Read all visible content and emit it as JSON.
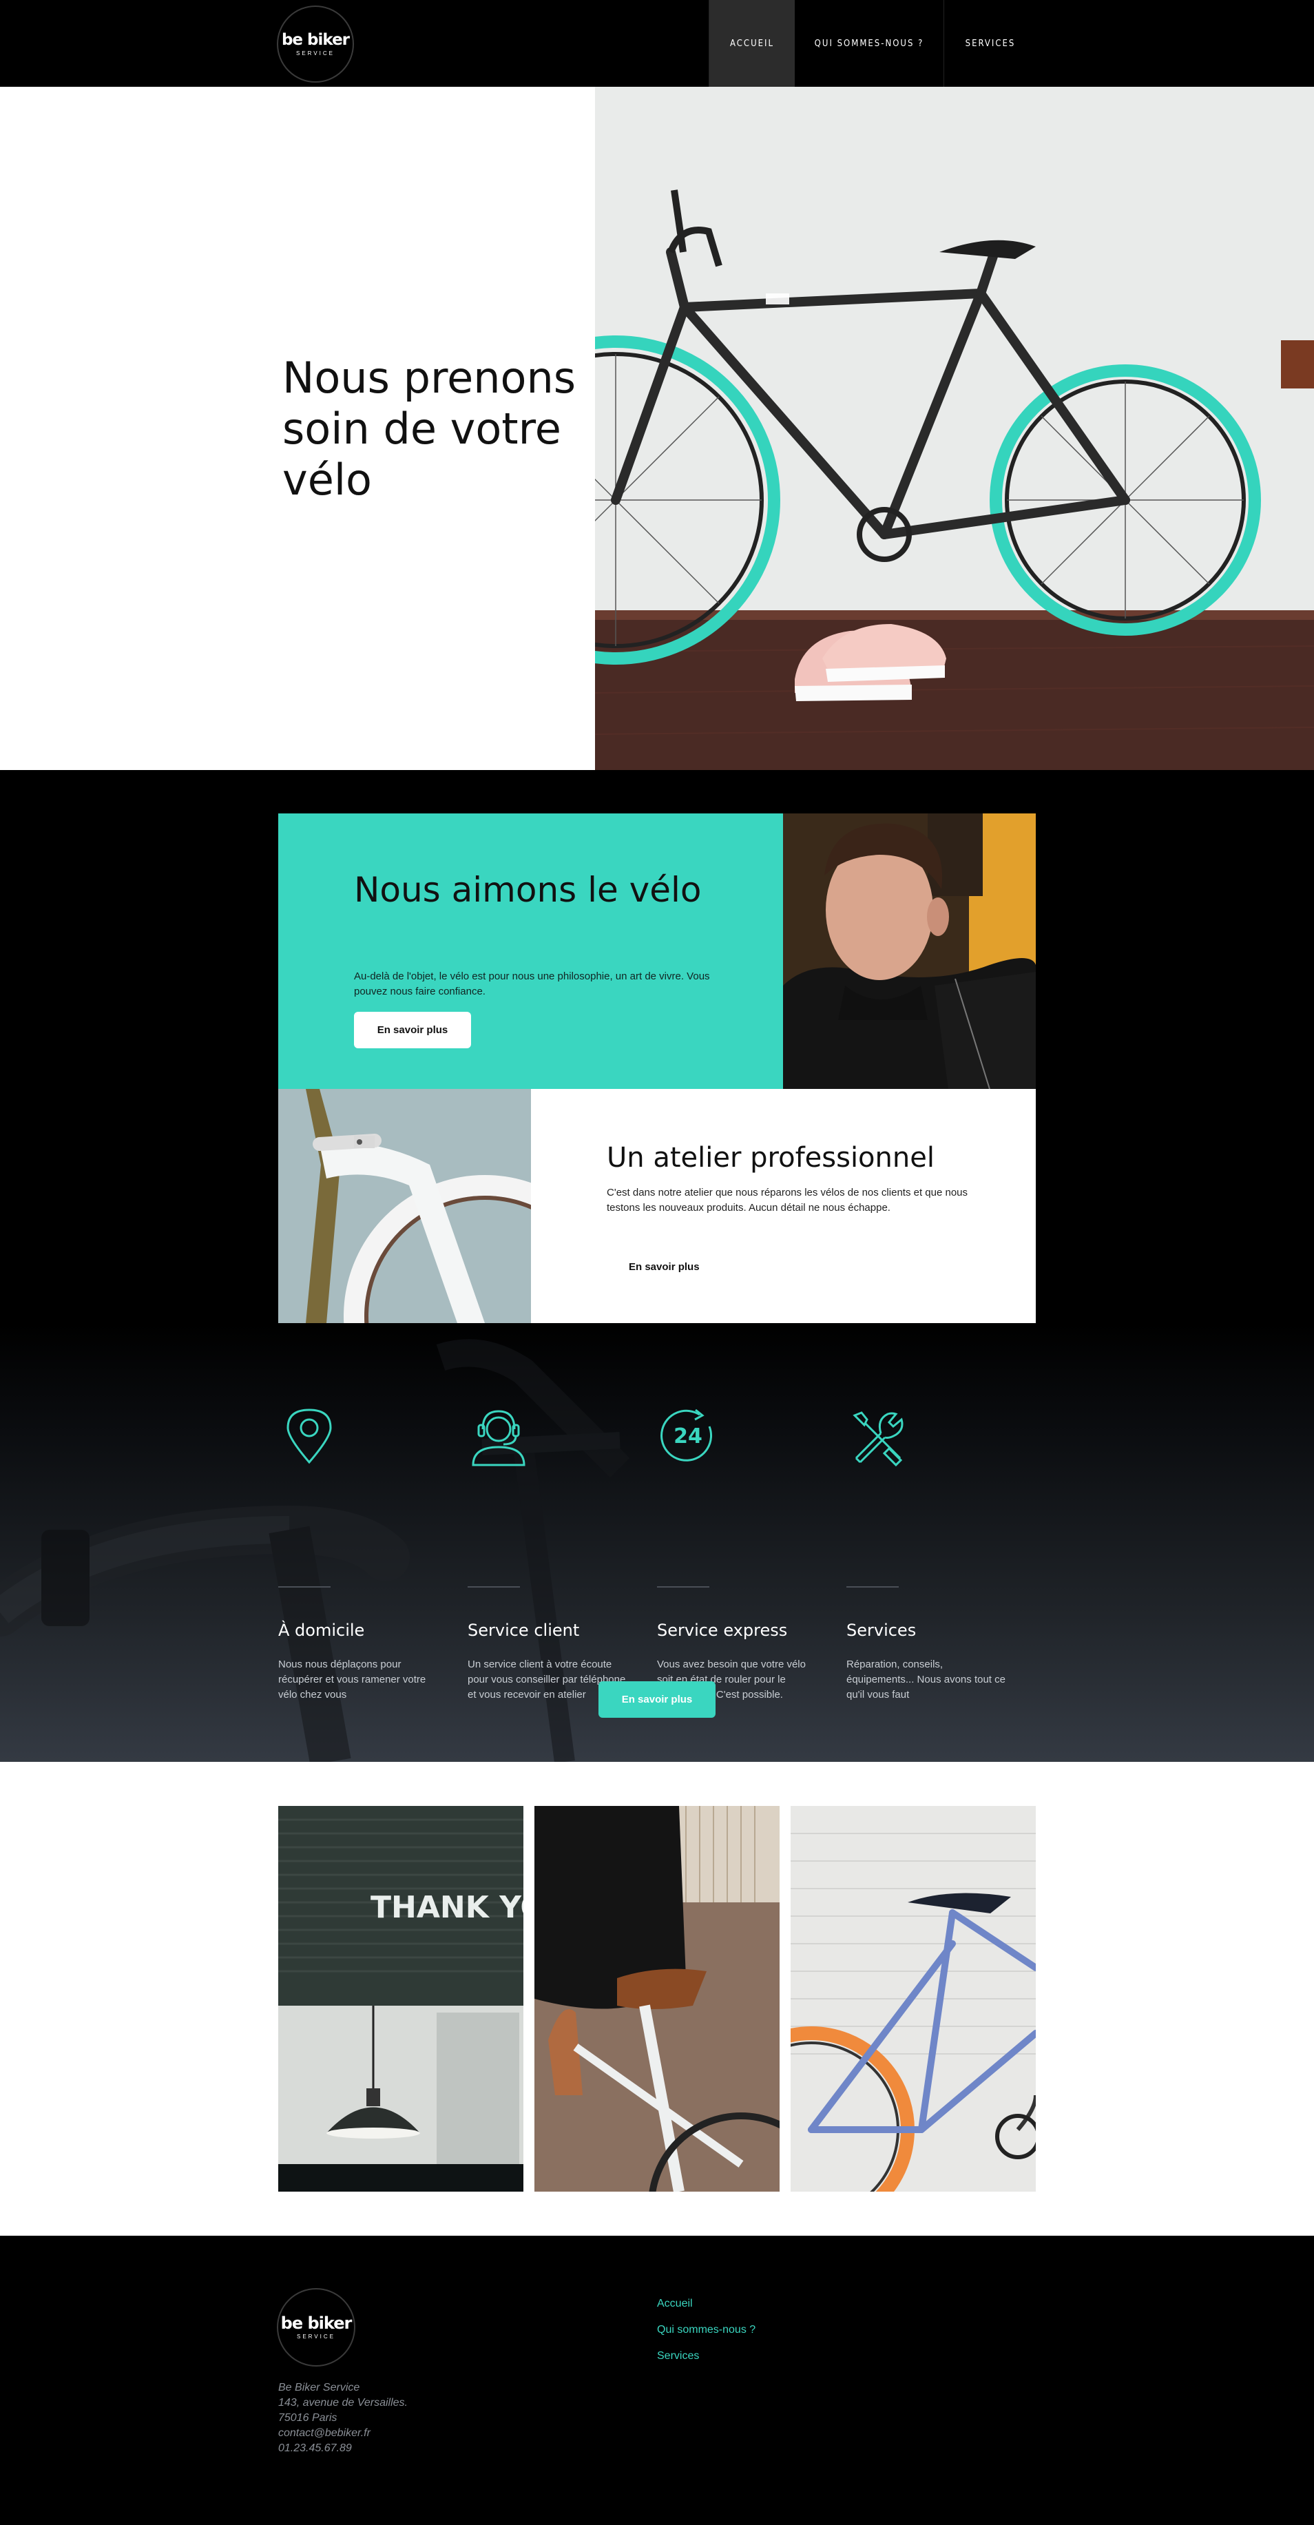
{
  "colors": {
    "accent": "#3ad6c0",
    "dark": "#000000",
    "text": "#111111"
  },
  "brand": {
    "logo_line1": "be biker",
    "logo_line2": "SERVICE"
  },
  "nav": {
    "items": [
      {
        "label": "ACCUEIL",
        "active": true
      },
      {
        "label": "QUI SOMMES-NOUS ?",
        "active": false
      },
      {
        "label": "SERVICES",
        "active": false
      }
    ]
  },
  "hero": {
    "title": "Nous prenons soin de votre vélo"
  },
  "love": {
    "title": "Nous aimons le vélo",
    "text": "Au-delà de l'objet, le vélo est pour nous une philosophie, un art de vivre. Vous pouvez nous faire confiance.",
    "button": "En savoir plus"
  },
  "atelier": {
    "title": "Un atelier professionnel",
    "text": "C'est dans notre atelier que nous réparons les vélos de nos clients et que nous testons les nouveaux produits. Aucun détail ne nous échappe.",
    "button": "En savoir plus"
  },
  "services": {
    "items": [
      {
        "icon": "location-pin-icon",
        "title": "À domicile",
        "text": "Nous nous déplaçons pour récupérer et vous ramener votre vélo chez vous"
      },
      {
        "icon": "customer-support-icon",
        "title": "Service client",
        "text": "Un service client à votre écoute pour vous conseiller par téléphone et vous recevoir en atelier"
      },
      {
        "icon": "24h-express-icon",
        "title": "Service express",
        "text": "Vous avez besoin que votre vélo soit en état de rouler pour le lendemain ? C'est possible."
      },
      {
        "icon": "tools-icon",
        "title": "Services",
        "text": "Réparation, conseils, équipements... Nous avons tout ce qu'il vous faut"
      }
    ],
    "express_badge": "24",
    "button": "En savoir plus"
  },
  "gallery": {
    "sign_text": "THANK YO"
  },
  "footer": {
    "address": [
      "Be Biker Service",
      "143, avenue de Versailles.",
      "75016 Paris",
      "contact@bebiker.fr",
      "01.23.45.67.89"
    ],
    "links": [
      "Accueil",
      "Qui sommes-nous ?",
      "Services"
    ]
  }
}
